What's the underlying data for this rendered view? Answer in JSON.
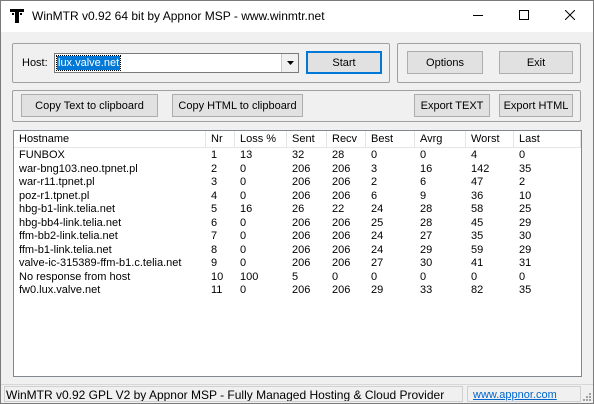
{
  "window": {
    "title": "WinMTR v0.92 64 bit by Appnor MSP - www.winmtr.net",
    "icon": "winmtr-app-icon",
    "controls": {
      "minimize": "minimize-icon",
      "maximize": "maximize-icon",
      "close": "close-icon"
    }
  },
  "host": {
    "label": "Host:",
    "value": "lux.valve.net"
  },
  "buttons": {
    "start": "Start",
    "options": "Options",
    "exit": "Exit",
    "copy_text": "Copy Text to clipboard",
    "copy_html": "Copy HTML to clipboard",
    "export_text": "Export TEXT",
    "export_html": "Export HTML"
  },
  "table": {
    "columns": [
      "Hostname",
      "Nr",
      "Loss %",
      "Sent",
      "Recv",
      "Best",
      "Avrg",
      "Worst",
      "Last"
    ],
    "rows": [
      [
        "FUNBOX",
        "1",
        "13",
        "32",
        "28",
        "0",
        "0",
        "4",
        "0"
      ],
      [
        "war-bng103.neo.tpnet.pl",
        "2",
        "0",
        "206",
        "206",
        "3",
        "16",
        "142",
        "35"
      ],
      [
        "war-r11.tpnet.pl",
        "3",
        "0",
        "206",
        "206",
        "2",
        "6",
        "47",
        "2"
      ],
      [
        "poz-r1.tpnet.pl",
        "4",
        "0",
        "206",
        "206",
        "6",
        "9",
        "36",
        "10"
      ],
      [
        "hbg-b1-link.telia.net",
        "5",
        "16",
        "26",
        "22",
        "24",
        "28",
        "58",
        "25"
      ],
      [
        "hbg-bb4-link.telia.net",
        "6",
        "0",
        "206",
        "206",
        "25",
        "28",
        "45",
        "29"
      ],
      [
        "ffm-bb2-link.telia.net",
        "7",
        "0",
        "206",
        "206",
        "24",
        "27",
        "35",
        "30"
      ],
      [
        "ffm-b1-link.telia.net",
        "8",
        "0",
        "206",
        "206",
        "24",
        "29",
        "59",
        "29"
      ],
      [
        "valve-ic-315389-ffm-b1.c.telia.net",
        "9",
        "0",
        "206",
        "206",
        "27",
        "30",
        "41",
        "31"
      ],
      [
        "No response from host",
        "10",
        "100",
        "5",
        "0",
        "0",
        "0",
        "0",
        "0"
      ],
      [
        "fw0.lux.valve.net",
        "11",
        "0",
        "206",
        "206",
        "29",
        "33",
        "82",
        "35"
      ]
    ]
  },
  "statusbar": {
    "text": "WinMTR v0.92 GPL V2 by Appnor MSP - Fully Managed Hosting & Cloud Provider",
    "link": "www.appnor.com"
  },
  "colors": {
    "selection": "#0078d7",
    "link": "#0066cc"
  }
}
